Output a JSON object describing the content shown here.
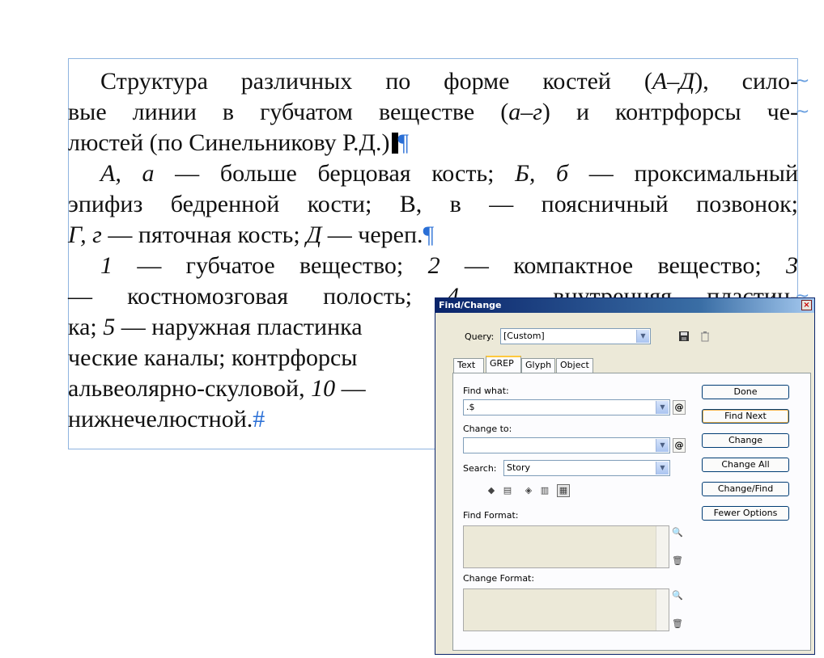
{
  "document": {
    "lines": [
      {
        "segments": [
          {
            "t": "Структура·различных·по·форме·костей·(",
            "i": false
          },
          {
            "t": "А–Д",
            "i": true
          },
          {
            "t": "),·сило-",
            "i": false
          }
        ]
      },
      {
        "segments": [
          {
            "t": "вые·линии·в·губчатом·веществе·(",
            "i": false
          },
          {
            "t": "а–г",
            "i": true
          },
          {
            "t": ")·и·контрфорсы·че-",
            "i": false
          }
        ]
      },
      {
        "segments": [
          {
            "t": "люстей·(по·Синельникову·Р.Д.)",
            "i": false
          }
        ]
      },
      {
        "segments": [
          {
            "t": "А,·а",
            "i": true
          },
          {
            "t": "·—·больше·берцовая·кость;·",
            "i": false
          },
          {
            "t": "Б,·б",
            "i": true
          },
          {
            "t": "·—·проксимальный",
            "i": false
          }
        ]
      },
      {
        "segments": [
          {
            "t": "эпифиз·бедренной·кости;·В,·в·—·поясничный·позвонок;",
            "i": false
          }
        ]
      },
      {
        "segments": [
          {
            "t": "Г,·г",
            "i": true
          },
          {
            "t": "·—·пяточная·кость;·",
            "i": false
          },
          {
            "t": "Д",
            "i": true
          },
          {
            "t": "·—·череп.",
            "i": false
          }
        ]
      },
      {
        "segments": [
          {
            "t": "1",
            "i": true
          },
          {
            "t": "·—·губчатое·вещество;·",
            "i": false
          },
          {
            "t": "2",
            "i": true
          },
          {
            "t": "·—·компактное·вещество;·",
            "i": false
          },
          {
            "t": "3",
            "i": true
          }
        ]
      },
      {
        "segments": [
          {
            "t": "—·костномозговая·полость;·",
            "i": false
          },
          {
            "t": "4",
            "i": true
          },
          {
            "t": "·—·внутренняя·пластин-",
            "i": false
          }
        ]
      },
      {
        "segments": [
          {
            "t": "ка;·",
            "i": false
          },
          {
            "t": "5",
            "i": true
          },
          {
            "t": "·—·наружная·пластинка",
            "i": false
          }
        ]
      },
      {
        "segments": [
          {
            "t": "ческие·каналы;·контрфорсы",
            "i": false
          }
        ]
      },
      {
        "segments": [
          {
            "t": "альвеолярно-скуловой,·",
            "i": false
          },
          {
            "t": "10",
            "i": true
          },
          {
            "t": "·—",
            "i": false
          }
        ]
      },
      {
        "segments": [
          {
            "t": "нижнечелюстной.",
            "i": false
          }
        ]
      }
    ],
    "pilcrow": "¶",
    "end_mark": "#",
    "hyphen_mark": "~"
  },
  "dialog": {
    "title": "Find/Change",
    "close_glyph": "×",
    "query_label": "Query:",
    "query_value": "[Custom]",
    "tabs": [
      "Text",
      "GREP",
      "Glyph",
      "Object"
    ],
    "selected_tab": "GREP",
    "find_what_label": "Find what:",
    "find_what_value": ".$",
    "change_to_label": "Change to:",
    "change_to_value": "",
    "search_label": "Search:",
    "search_value": "Story",
    "find_format_label": "Find Format:",
    "change_format_label": "Change Format:",
    "at_symbol": "@",
    "buttons": [
      "Done",
      "Find Next",
      "Change",
      "Change All",
      "Change/Find",
      "Fewer Options"
    ]
  }
}
